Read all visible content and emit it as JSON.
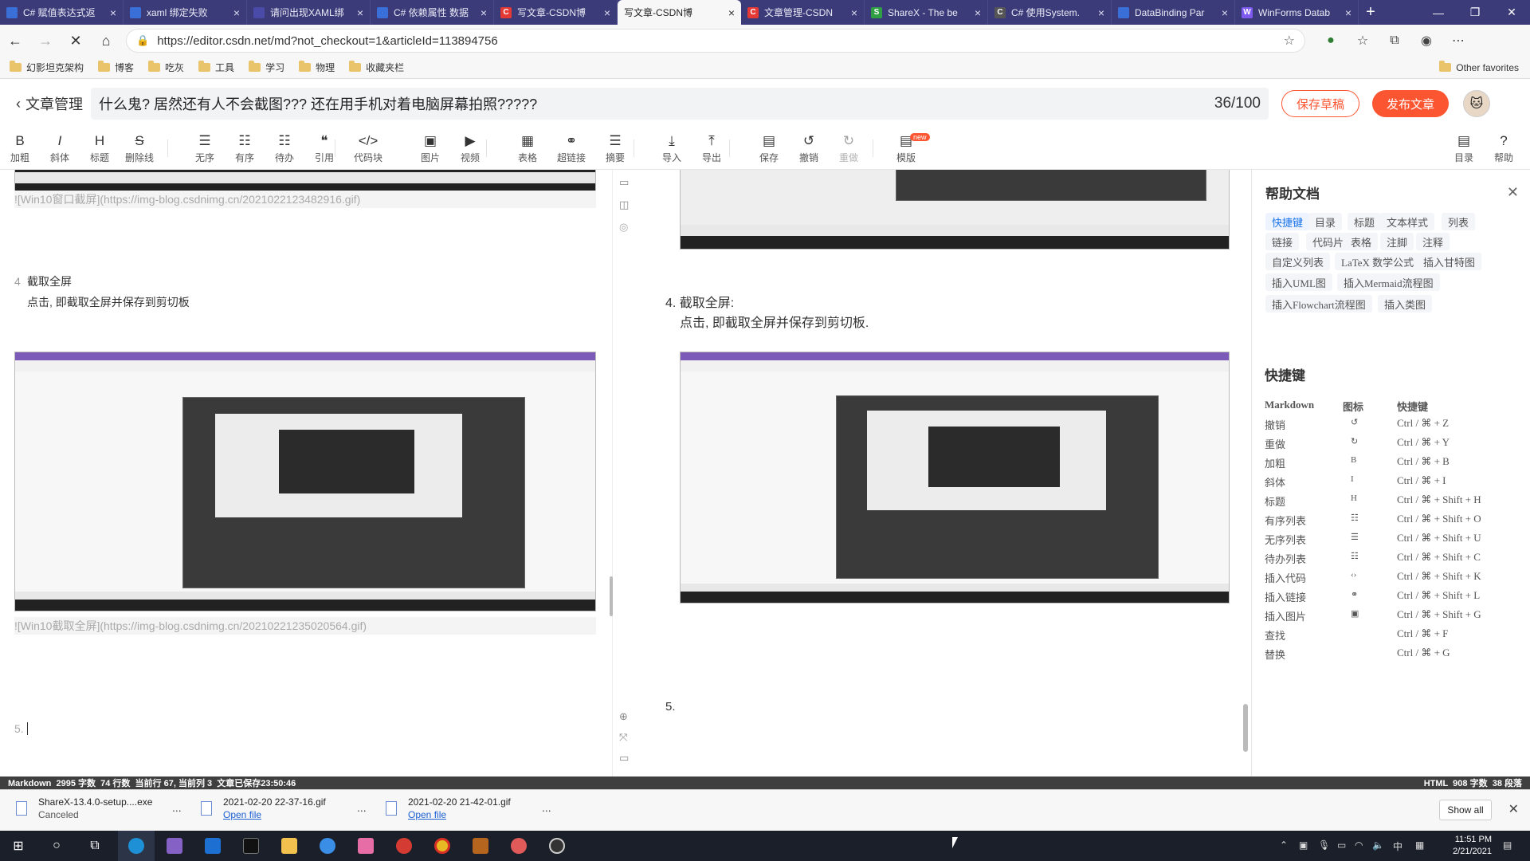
{
  "browser": {
    "tabs": [
      {
        "title": "C# 赋值表达式返",
        "fav": "vs",
        "color": "#3b6fd8"
      },
      {
        "title": "xaml 绑定失败",
        "fav": "vs",
        "color": "#3b6fd8"
      },
      {
        "title": "请问出现XAML绑",
        "fav": "vs",
        "color": "#4a4aa8"
      },
      {
        "title": "C# 依赖属性 数据",
        "fav": "vs",
        "color": "#3b6fd8"
      },
      {
        "title": "写文章-CSDN博",
        "fav": "C",
        "color": "#e53935"
      },
      {
        "title": "写文章-CSDN博",
        "fav": "",
        "color": "#f7f7f7",
        "active": true
      },
      {
        "title": "文章管理-CSDN",
        "fav": "C",
        "color": "#e53935"
      },
      {
        "title": "ShareX - The be",
        "fav": "S",
        "color": "#2ea043"
      },
      {
        "title": "C# 使用System.",
        "fav": "C",
        "color": "#555"
      },
      {
        "title": "DataBinding Par",
        "fav": "vs",
        "color": "#3b6fd8"
      },
      {
        "title": "WinForms Datab",
        "fav": "W",
        "color": "#7f5af0"
      }
    ],
    "new_tab": "+",
    "window_controls": [
      "—",
      "❐",
      "✕"
    ],
    "url": "https://editor.csdn.net/md?not_checkout=1&articleId=113894756",
    "bookmarks": [
      "幻影坦克架构",
      "博客",
      "吃灰",
      "工具",
      "学习",
      "物理",
      "收藏夹栏"
    ],
    "other_favorites": "Other favorites"
  },
  "header": {
    "back_label": "文章管理",
    "title": "什么鬼? 居然还有人不会截图??? 还在用手机对着电脑屏幕拍照?????",
    "char_count": "36/100",
    "save_draft": "保存草稿",
    "publish": "发布文章"
  },
  "toolbar": [
    {
      "label": "加粗",
      "icon": "B"
    },
    {
      "label": "斜体",
      "icon": "I"
    },
    {
      "label": "标题",
      "icon": "H"
    },
    {
      "label": "删除线",
      "icon": "S"
    },
    {
      "label": "无序",
      "icon": "☰"
    },
    {
      "label": "有序",
      "icon": "☷"
    },
    {
      "label": "待办",
      "icon": "☷"
    },
    {
      "label": "引用",
      "icon": "❝"
    },
    {
      "label": "代码块",
      "icon": "</>"
    },
    {
      "label": "图片",
      "icon": "▣"
    },
    {
      "label": "视频",
      "icon": "▶"
    },
    {
      "label": "表格",
      "icon": "▦"
    },
    {
      "label": "超链接",
      "icon": "⚭"
    },
    {
      "label": "摘要",
      "icon": "☰"
    },
    {
      "label": "导入",
      "icon": "⤓"
    },
    {
      "label": "导出",
      "icon": "⤒"
    },
    {
      "label": "保存",
      "icon": "▤"
    },
    {
      "label": "撤销",
      "icon": "↺"
    },
    {
      "label": "重做",
      "icon": "↻"
    },
    {
      "label": "模版",
      "icon": "▤"
    },
    {
      "label": "目录",
      "icon": "▤"
    },
    {
      "label": "帮助",
      "icon": "?"
    }
  ],
  "template_badge": "new",
  "editor": {
    "link1": "![Win10窗口截屏](https://img-blog.csdnimg.cn/2021022123482916.gif)",
    "line_no": "4",
    "item_title": "截取全屏",
    "item_desc": "点击, 即截取全屏并保存到剪切板",
    "link2": "![Win10截取全屏](https://img-blog.csdnimg.cn/20210221235020564.gif)",
    "line5": "5."
  },
  "preview": {
    "item_title": "4. 截取全屏:",
    "item_desc": "点击, 即截取全屏并保存到剪切板.",
    "line5": "5."
  },
  "help": {
    "title": "帮助文档",
    "chips": [
      "快捷键",
      "目录",
      "标题",
      "文本样式",
      "列表",
      "链接",
      "代码片",
      "表格",
      "注脚",
      "注释",
      "自定义列表",
      "LaTeX 数学公式",
      "插入甘特图",
      "插入UML图",
      "插入Mermaid流程图",
      "插入Flowchart流程图",
      "插入类图"
    ],
    "shortcut_title": "快捷键",
    "col_markdown": "Markdown",
    "col_icon": "图标",
    "col_key": "快捷键",
    "rows": [
      {
        "name": "撤销",
        "icon": "↺",
        "key": "Ctrl / ⌘ + Z"
      },
      {
        "name": "重做",
        "icon": "↻",
        "key": "Ctrl / ⌘ + Y"
      },
      {
        "name": "加粗",
        "icon": "B",
        "key": "Ctrl / ⌘ + B"
      },
      {
        "name": "斜体",
        "icon": "I",
        "key": "Ctrl / ⌘ + I"
      },
      {
        "name": "标题",
        "icon": "H",
        "key": "Ctrl / ⌘ + Shift + H"
      },
      {
        "name": "有序列表",
        "icon": "☷",
        "key": "Ctrl / ⌘ + Shift + O"
      },
      {
        "name": "无序列表",
        "icon": "☰",
        "key": "Ctrl / ⌘ + Shift + U"
      },
      {
        "name": "待办列表",
        "icon": "☷",
        "key": "Ctrl / ⌘ + Shift + C"
      },
      {
        "name": "插入代码",
        "icon": "‹›",
        "key": "Ctrl / ⌘ + Shift + K"
      },
      {
        "name": "插入链接",
        "icon": "⚭",
        "key": "Ctrl / ⌘ + Shift + L"
      },
      {
        "name": "插入图片",
        "icon": "▣",
        "key": "Ctrl / ⌘ + Shift + G"
      },
      {
        "name": "查找",
        "icon": "",
        "key": "Ctrl / ⌘ + F"
      },
      {
        "name": "替换",
        "icon": "",
        "key": "Ctrl / ⌘ + G"
      }
    ]
  },
  "status": {
    "left": "Markdown  2995 字数  74 行数  当前行 67, 当前列 3  文章已保存23:50:46",
    "right": "HTML  908 字数  38 段落"
  },
  "downloads": [
    {
      "name": "ShareX-13.4.0-setup....exe",
      "sub": "Canceled",
      "link": false
    },
    {
      "name": "2021-02-20 22-37-16.gif",
      "sub": "Open file",
      "link": true
    },
    {
      "name": "2021-02-20 21-42-01.gif",
      "sub": "Open file",
      "link": true
    }
  ],
  "download_more": "...",
  "show_all": "Show all",
  "taskbar": {
    "time": "11:51 PM",
    "date": "2/21/2021",
    "ime": "中"
  }
}
